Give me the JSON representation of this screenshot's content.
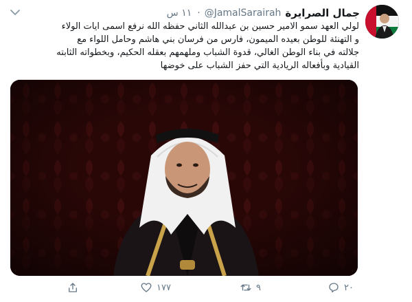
{
  "tweet": {
    "display_name": "جمال الصرايرة",
    "handle": "@JamalSarairah",
    "separator": "·",
    "timestamp": "١١ س",
    "text_lines": [
      "لولي العهد  سمو الامير حسين بن عبدالله الثاني حفظه الله نرفع اسمى ايات الولاء",
      "و التهنئة للوطن بعيده الميمون، فارس من فرسان بني هاشم وحامل اللواء مع",
      "جلالته في بناء الوطن الغالي، قدوة الشباب وملهمهم بعقله الحكيم، وبخطواته الثابته",
      "القيادية وبأفعاله الريادية التي حفز الشباب على خوضها"
    ]
  },
  "actions": {
    "reply_count": "٢٠",
    "retweet_count": "٩",
    "like_count": "١٧٧",
    "share_count": ""
  },
  "colors": {
    "text": "#14171a",
    "muted": "#657786",
    "media_background": "#3a0c0c"
  },
  "icons": {
    "reply": "reply-icon",
    "retweet": "retweet-icon",
    "like": "heart-icon",
    "share": "share-icon",
    "menu": "chevron-down-icon"
  }
}
